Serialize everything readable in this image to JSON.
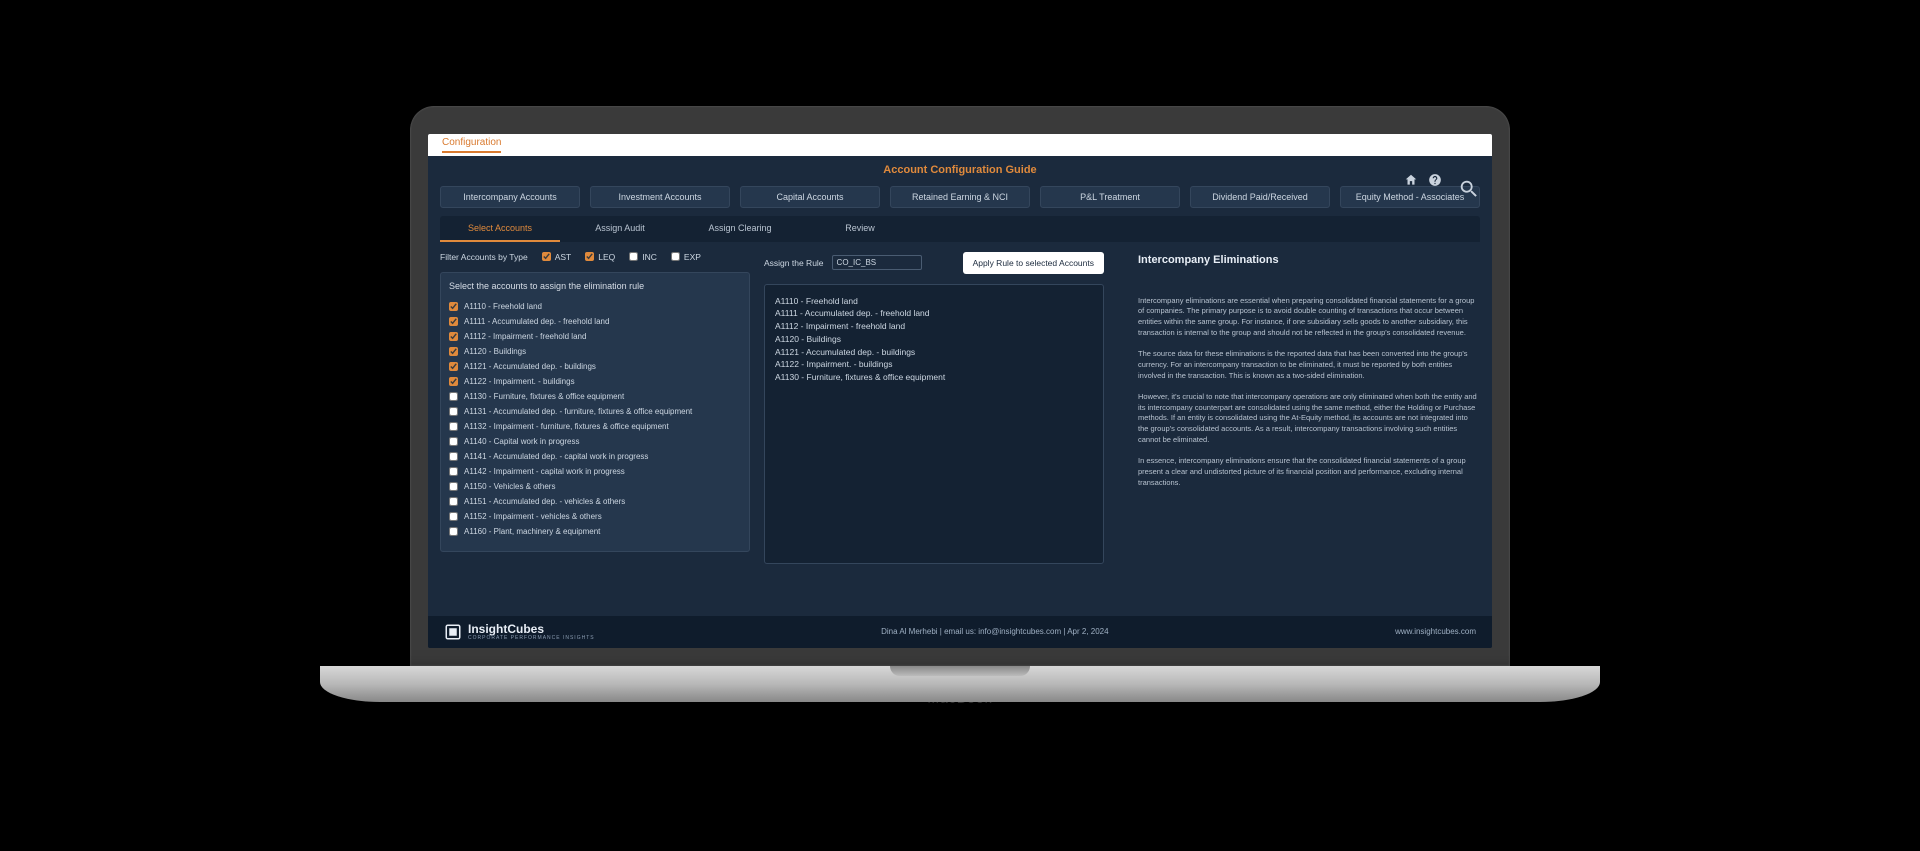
{
  "topbar": {
    "tab": "Configuration"
  },
  "guide_title": "Account Configuration Guide",
  "pills": [
    "Intercompany Accounts",
    "Investment Accounts",
    "Capital Accounts",
    "Retained Earning & NCI",
    "P&L Treatment",
    "Dividend Paid/Received",
    "Equity Method - Associates"
  ],
  "subtabs": [
    {
      "label": "Select Accounts",
      "active": true
    },
    {
      "label": "Assign Audit",
      "active": false
    },
    {
      "label": "Assign Clearing",
      "active": false
    },
    {
      "label": "Review",
      "active": false
    }
  ],
  "filter": {
    "label": "Filter Accounts by Type",
    "types": [
      {
        "code": "AST",
        "checked": true
      },
      {
        "code": "LEQ",
        "checked": true
      },
      {
        "code": "INC",
        "checked": false
      },
      {
        "code": "EXP",
        "checked": false
      }
    ]
  },
  "account_select_header": "Select the accounts to assign the elimination rule",
  "accounts": [
    {
      "code": "A1110",
      "label": "Freehold land",
      "checked": true
    },
    {
      "code": "A1111",
      "label": "Accumulated dep. - freehold land",
      "checked": true
    },
    {
      "code": "A1112",
      "label": "Impairment - freehold land",
      "checked": true
    },
    {
      "code": "A1120",
      "label": "Buildings",
      "checked": true
    },
    {
      "code": "A1121",
      "label": "Accumulated dep. - buildings",
      "checked": true
    },
    {
      "code": "A1122",
      "label": "Impairment. - buildings",
      "checked": true
    },
    {
      "code": "A1130",
      "label": "Furniture, fixtures & office equipment",
      "checked": false
    },
    {
      "code": "A1131",
      "label": "Accumulated dep. - furniture, fixtures & office equipment",
      "checked": false
    },
    {
      "code": "A1132",
      "label": "Impairment - furniture, fixtures & office equipment",
      "checked": false
    },
    {
      "code": "A1140",
      "label": "Capital work in progress",
      "checked": false
    },
    {
      "code": "A1141",
      "label": "Accumulated dep. - capital work in progress",
      "checked": false
    },
    {
      "code": "A1142",
      "label": "Impairment - capital work in progress",
      "checked": false
    },
    {
      "code": "A1150",
      "label": "Vehicles & others",
      "checked": false
    },
    {
      "code": "A1151",
      "label": "Accumulated dep. - vehicles & others",
      "checked": false
    },
    {
      "code": "A1152",
      "label": "Impairment - vehicles & others",
      "checked": false
    },
    {
      "code": "A1160",
      "label": "Plant, machinery & equipment",
      "checked": false
    }
  ],
  "assign": {
    "label": "Assign the Rule",
    "rule_value": "CO_IC_BS",
    "apply_button": "Apply Rule to selected Accounts"
  },
  "selected_accounts": [
    "A1110 - Freehold land",
    "A1111 - Accumulated dep. - freehold land",
    "A1112 - Impairment - freehold land",
    "A1120 - Buildings",
    "A1121 - Accumulated dep. - buildings",
    "A1122 - Impairment. - buildings",
    "A1130 - Furniture, fixtures & office equipment"
  ],
  "info": {
    "title": "Intercompany Eliminations",
    "paras": [
      "Intercompany eliminations are essential when preparing consolidated financial statements for a group of companies. The primary purpose is to avoid double counting of transactions that occur between entities within the same group. For instance, if one subsidiary sells goods to another subsidiary, this transaction is internal to the group and should not be reflected in the group's consolidated revenue.",
      "The source data for these eliminations is the reported data that has been converted into the group's currency. For an intercompany transaction to be eliminated, it must be reported by both entities involved in the transaction. This is known as a two-sided elimination.",
      "However, it's crucial to note that intercompany operations are only eliminated when both the entity and its intercompany counterpart are consolidated using the same method, either the Holding or Purchase methods. If an entity is consolidated using the At-Equity method, its accounts are not integrated into the group's consolidated accounts. As a result, intercompany transactions involving such entities cannot be eliminated.",
      "In essence, intercompany eliminations ensure that the consolidated financial statements of a group present a clear and undistorted picture of its financial position and performance, excluding internal transactions."
    ]
  },
  "footer": {
    "brand": "InsightCubes",
    "tagline": "CORPORATE PERFORMANCE INSIGHTS",
    "center": "Dina Al Merhebi | email us: info@insightcubes.com | Apr 2, 2024",
    "url": "www.insightcubes.com"
  },
  "macbook": "MacBook"
}
